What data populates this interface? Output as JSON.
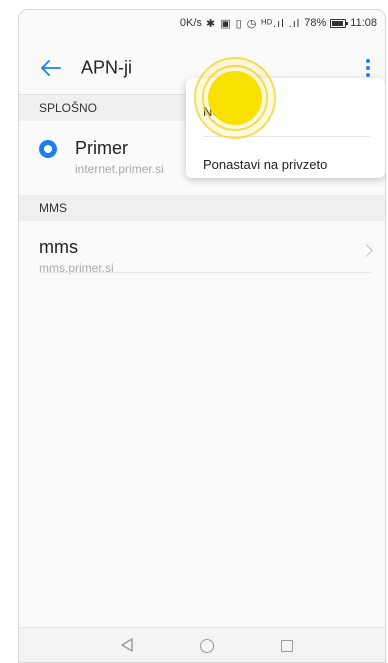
{
  "status_bar": {
    "speed": "0K/s",
    "icons": "✱ ▣ ▯ ◷ ᴴᴰ.ıl .ıl",
    "battery": "78%",
    "time": "11:08"
  },
  "app_bar": {
    "title": "APN-ji",
    "back_icon": "arrow-left-icon",
    "more_icon": "more-vert-icon"
  },
  "sections": {
    "general": {
      "header": "SPLOŠNO",
      "apn": {
        "name": "Primer",
        "address": "internet.primer.si",
        "selected": true
      }
    },
    "mms": {
      "header": "MMS",
      "apn": {
        "name": "mms",
        "address": "mms.primer.si"
      }
    }
  },
  "menu": {
    "items": [
      {
        "label": "Nov APN"
      },
      {
        "label": "Ponastavi na privzeto"
      }
    ]
  },
  "nav_bar": {
    "icons": [
      "triangle-back-icon",
      "circle-home-icon",
      "square-recent-icon"
    ]
  },
  "colors": {
    "accent": "#1e7ef0",
    "tap_highlight": "#f8e100"
  }
}
